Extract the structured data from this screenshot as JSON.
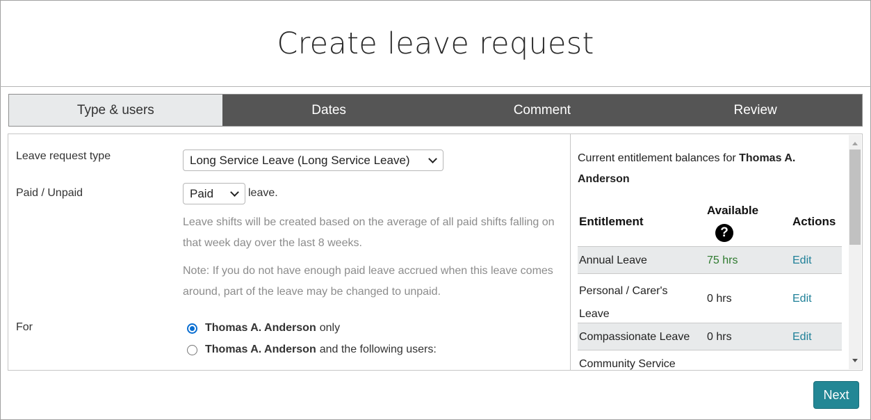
{
  "page": {
    "title": "Create leave request"
  },
  "tabs": [
    {
      "label": "Type & users",
      "active": true
    },
    {
      "label": "Dates",
      "active": false
    },
    {
      "label": "Comment",
      "active": false
    },
    {
      "label": "Review",
      "active": false
    }
  ],
  "form": {
    "leave_type_label": "Leave request type",
    "leave_type_value": "Long Service Leave (Long Service Leave)",
    "paid_label": "Paid / Unpaid",
    "paid_value": "Paid",
    "paid_suffix": "leave.",
    "help_1": "Leave shifts will be created based on the average of all paid shifts falling on that week day over the last 8 weeks.",
    "help_2": "Note: If you do not have enough paid leave accrued when this leave comes around, part of the leave may be changed to unpaid.",
    "for_label": "For",
    "for_options": [
      {
        "name": "Thomas A. Anderson",
        "suffix": "only",
        "checked": true
      },
      {
        "name": "Thomas A. Anderson",
        "suffix": "and the following users:",
        "checked": false
      }
    ]
  },
  "entitlements": {
    "heading_prefix": "Current entitlement balances for",
    "heading_user": "Thomas A. Anderson",
    "columns": {
      "entitlement": "Entitlement",
      "available": "Available",
      "actions": "Actions"
    },
    "help_icon": "question-circle-icon",
    "rows": [
      {
        "name": "Annual Leave",
        "available": "75 hrs",
        "action": "Edit"
      },
      {
        "name": "Personal / Carer's Leave",
        "available": "0 hrs",
        "action": "Edit"
      },
      {
        "name": "Compassionate Leave",
        "available": "0 hrs",
        "action": "Edit"
      },
      {
        "name": "Community Service",
        "available": "",
        "action": ""
      }
    ]
  },
  "footer": {
    "next_label": "Next"
  },
  "colors": {
    "tab_bar": "#555555",
    "tab_active": "#e8eaeb",
    "accent": "#238795",
    "link": "#1f8098",
    "positive": "#2e7a2e",
    "radio": "#0a6ed1"
  }
}
